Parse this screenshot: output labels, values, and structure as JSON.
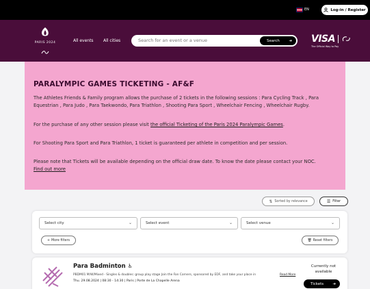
{
  "topbar": {
    "language": "EN",
    "login_label": "Log-in / Register"
  },
  "header": {
    "logo_text": "PARIS 2024",
    "nav": [
      "All events",
      "All cities"
    ],
    "search": {
      "placeholder": "Search for an event or a venue",
      "button_label": "Search"
    },
    "sponsor": {
      "name": "VISA",
      "tagline": "The Official Way to Pay"
    }
  },
  "info": {
    "title": "PARALYMPIC GAMES TICKETING - AF&F",
    "p1": "The Athletes Friends & Family program allows the purchase of 2 tickets in the following sessions : Para Cycling Track , Para Equestrian , Para Judo , Para Taekwondo, Para Triathlon , Shooting Para Sport , Wheelchair Fencing , Wheelchair Rugby.",
    "p2_prefix": "For the purchase of any other session please visit ",
    "p2_link": "the official Ticketing of the Paris 2024 Paralympic Games",
    "p2_suffix": ".",
    "p3": "For Shooting Para Sport and Para Triathlon, 1 ticket is guaranteed per athlete in competition and per session.",
    "p4": "Please note that Tickets will be available depending on the official draw date. To know the date please contact your NOC.",
    "p4_link": "Find out more"
  },
  "controls": {
    "sort_label": "Sorted by relevance",
    "filter_label": "Filter"
  },
  "filters": {
    "city": "Select city",
    "event": "Select event",
    "venue": "Select venue",
    "more_filters": "More filters",
    "reset": "Reset filters"
  },
  "event": {
    "title": "Para Badminton",
    "description": "PBDM01 M/W/Mixed - Singles & doubles: group play stage Join the Fan Corners, sponsored by EDF, and take your place in",
    "read_more": "Read More",
    "date": "Thu. 29.08.2024",
    "time": "08:30 - 14:30",
    "city": "Paris",
    "venue": "Porte de La Chapelle Arena",
    "availability": "Currently not available",
    "button_label": "Tickets"
  },
  "colors": {
    "header_bg": "#4a0d3a",
    "info_bg": "#f4a6cf",
    "pictogram": "#b56bb0"
  }
}
